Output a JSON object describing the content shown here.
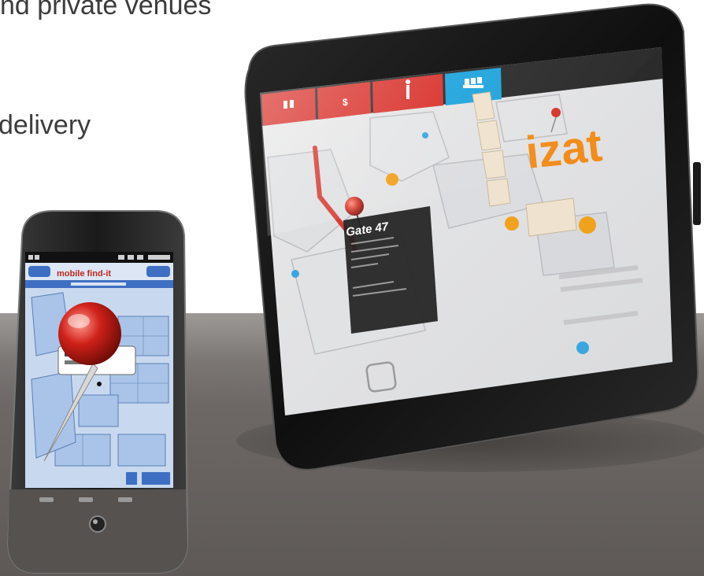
{
  "slide": {
    "line1": "nd private venues",
    "line2": "delivery"
  },
  "tablet": {
    "nav_tabs": [
      {
        "label": "",
        "icon": "shops-icon",
        "active": false
      },
      {
        "label": "",
        "icon": "dollar-icon",
        "active": false
      },
      {
        "label": "",
        "icon": "restroom-icon",
        "active": false
      },
      {
        "label": "",
        "icon": "seats-icon",
        "active": true
      }
    ],
    "logo_text": "izat",
    "popup": {
      "title": "Gate 47"
    },
    "colors": {
      "nav_red": "#d9322c",
      "nav_active_blue": "#1fa4dc",
      "route_red": "#d63a33",
      "marker_orange": "#f0a21c",
      "logo_orange": "#f28c1a"
    }
  },
  "phone": {
    "header_text": "mobile find-it",
    "colors": {
      "header_blue": "#3f6fc2",
      "map_blue": "#a9c4e8",
      "pin_red": "#d0211a"
    }
  }
}
